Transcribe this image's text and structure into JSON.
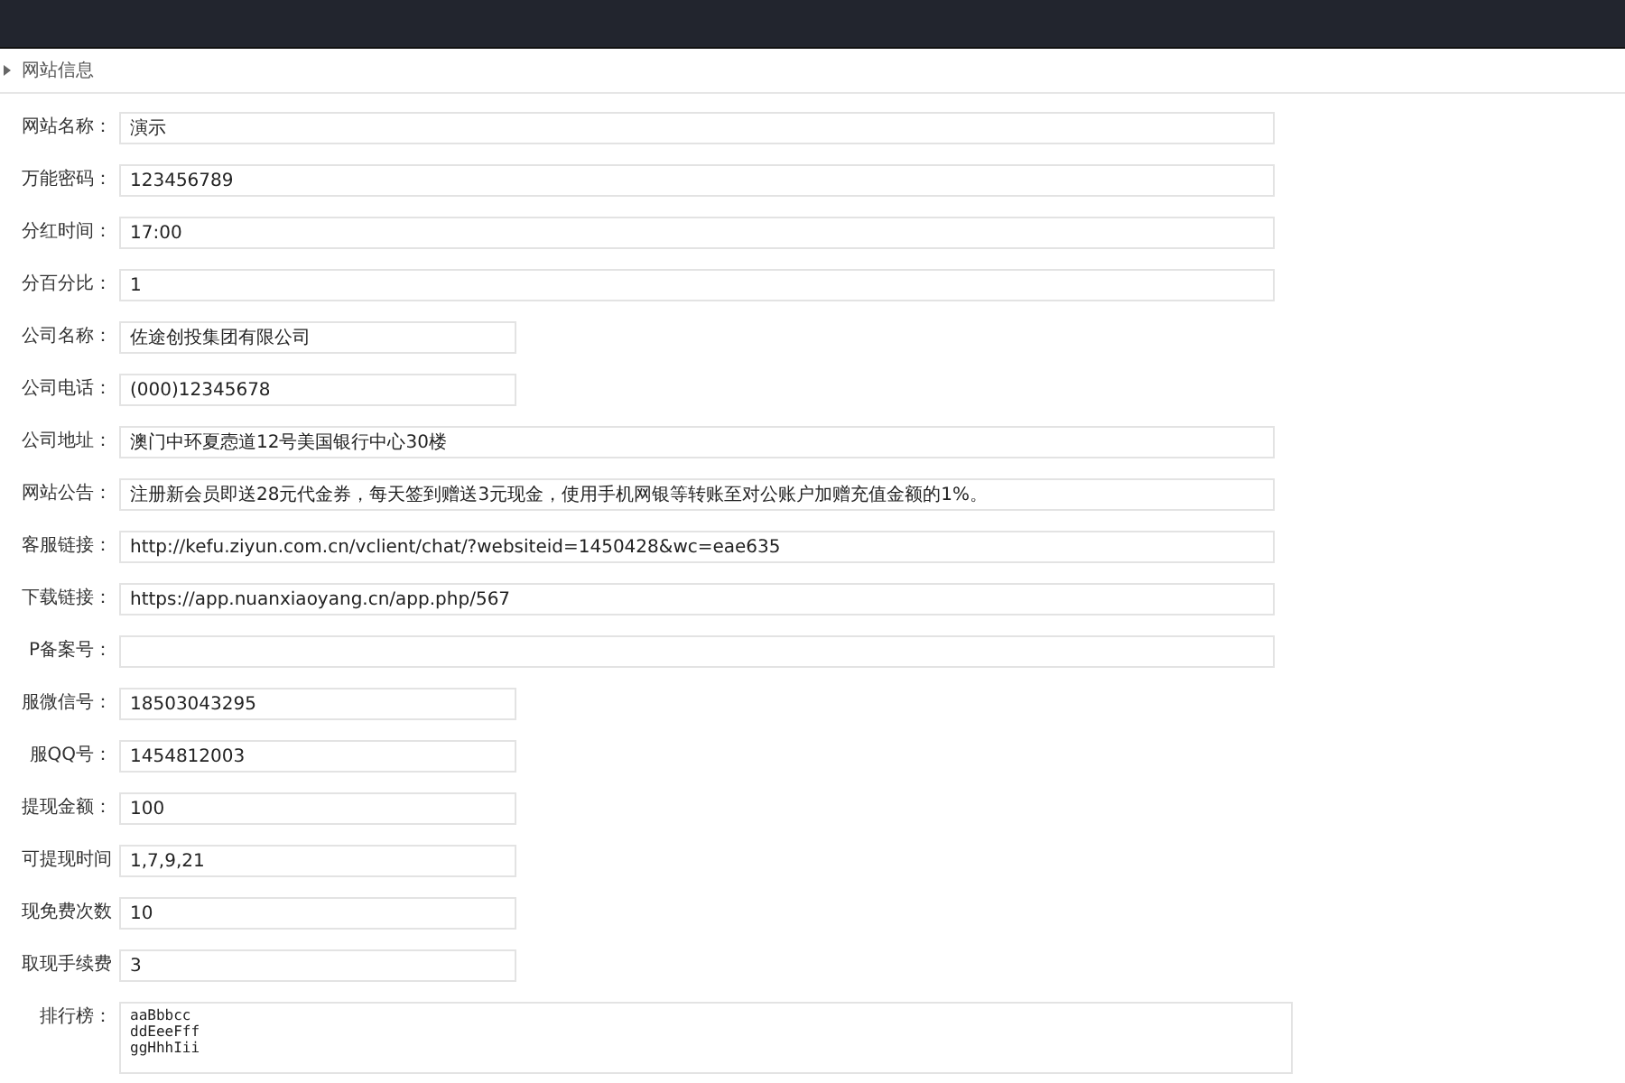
{
  "header": {
    "title": "网站信息"
  },
  "fields": [
    {
      "label": "网站名称：",
      "value": "演示",
      "kind": "wide"
    },
    {
      "label": "万能密码：",
      "value": "123456789",
      "kind": "wide"
    },
    {
      "label": "分红时间：",
      "value": "17:00",
      "kind": "wide"
    },
    {
      "label": "分百分比：",
      "value": "1",
      "kind": "wide"
    },
    {
      "label": "公司名称：",
      "value": "佐途创投集团有限公司",
      "kind": "short"
    },
    {
      "label": "公司电话：",
      "value": "(000)12345678",
      "kind": "short"
    },
    {
      "label": "公司地址：",
      "value": "澳门中环夏悫道12号美国银行中心30楼",
      "kind": "wide"
    },
    {
      "label": "网站公告：",
      "value": "注册新会员即送28元代金券，每天签到赠送3元现金，使用手机网银等转账至对公账户加赠充值金额的1%。",
      "kind": "wide"
    },
    {
      "label": "客服链接：",
      "value": "http://kefu.ziyun.com.cn/vclient/chat/?websiteid=1450428&wc=eae635",
      "kind": "wide"
    },
    {
      "label": "下载链接：",
      "value": "https://app.nuanxiaoyang.cn/app.php/567",
      "kind": "wide"
    },
    {
      "label": "P备案号：",
      "kind": "wide"
    },
    {
      "label": "服微信号：",
      "value": "18503043295",
      "kind": "short"
    },
    {
      "label": "服QQ号：",
      "value": "1454812003",
      "kind": "short"
    },
    {
      "label": "提现金额：",
      "value": "100",
      "kind": "short"
    },
    {
      "label": "可提现时间",
      "value": "1,7,9,21",
      "kind": "short"
    },
    {
      "label": "现免费次数",
      "value": "10",
      "kind": "short"
    },
    {
      "label": "取现手续费",
      "value": "3",
      "kind": "short"
    },
    {
      "label": "排行榜：",
      "value": "aaBbbcc\nddEeeFff\nggHhhIii",
      "kind": "textarea"
    }
  ]
}
